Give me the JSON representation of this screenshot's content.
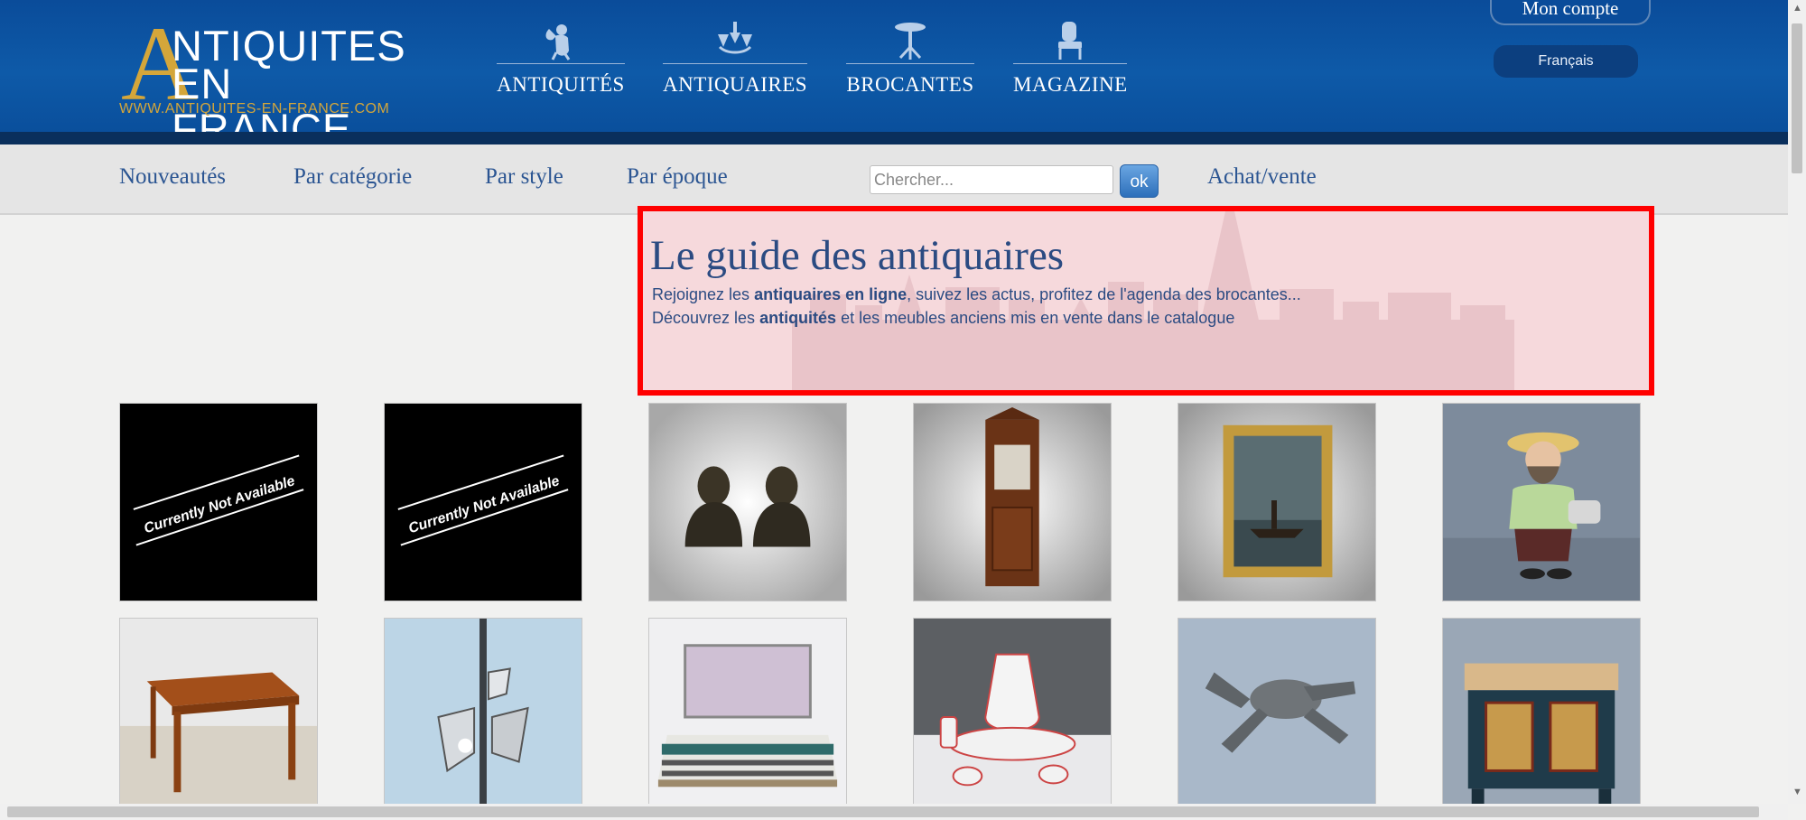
{
  "logo": {
    "letter": "A",
    "line1": "NTIQUITES",
    "line2": "EN FRANCE",
    "url": "WWW.ANTIQUITES-EN-FRANCE.COM"
  },
  "nav": [
    {
      "label": "ANTIQUITÉS",
      "icon": "cherub-icon"
    },
    {
      "label": "ANTIQUAIRES",
      "icon": "chandelier-icon"
    },
    {
      "label": "BROCANTES",
      "icon": "gueridon-table-icon"
    },
    {
      "label": "MAGAZINE",
      "icon": "chair-icon"
    }
  ],
  "account": {
    "label": "Mon compte",
    "language": "Français"
  },
  "subnav": {
    "items": [
      "Nouveautés",
      "Par catégorie",
      "Par style",
      "Par époque"
    ],
    "search_placeholder": "Chercher...",
    "ok_label": "ok",
    "achat_vente": "Achat/vente"
  },
  "guide": {
    "title": "Le guide des antiquaires",
    "line1": {
      "pre": "Rejoignez les ",
      "bold": "antiquaires en ligne",
      "post": ", suivez les actus, profitez de l'agenda des brocantes..."
    },
    "line2": {
      "pre": "Découvrez les ",
      "bold": "antiquités",
      "post": " et les meubles anciens mis en vente dans le catalogue"
    }
  },
  "products": [
    {
      "kind": "unavailable",
      "label": "Currently Not Available"
    },
    {
      "kind": "unavailable",
      "label": "Currently Not Available"
    },
    {
      "kind": "image",
      "subject": "bronze-busts"
    },
    {
      "kind": "image",
      "subject": "carved-wood-cabinet"
    },
    {
      "kind": "image",
      "subject": "framed-painting"
    },
    {
      "kind": "image",
      "subject": "ceramic-figure"
    },
    {
      "kind": "image",
      "subject": "wooden-table"
    },
    {
      "kind": "image",
      "subject": "metal-lamp"
    },
    {
      "kind": "image",
      "subject": "iron-bed"
    },
    {
      "kind": "image",
      "subject": "ceramic-pitcher-basin"
    },
    {
      "kind": "image",
      "subject": "pewter-lobster"
    },
    {
      "kind": "image",
      "subject": "painted-chest"
    }
  ],
  "colors": {
    "header": "#0e5aa8",
    "header_dark": "#0a2f5c",
    "gold": "#d4a63a",
    "link": "#2b5592",
    "highlight_border": "#ff0000"
  }
}
